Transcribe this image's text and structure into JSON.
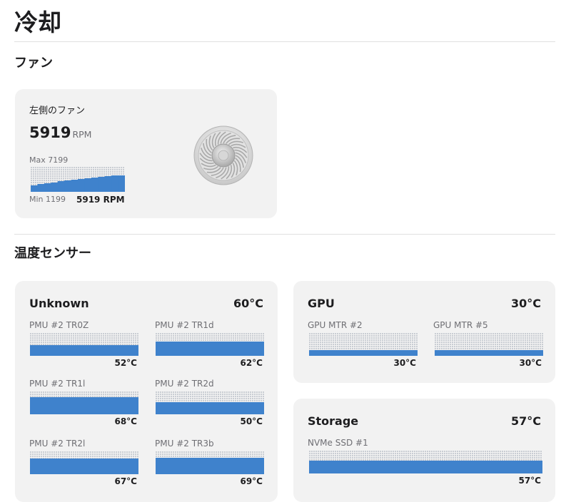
{
  "title": "冷却",
  "fans_section": {
    "title": "ファン",
    "fans": [
      {
        "name": "左側のファン",
        "rpm": "5919",
        "unit": "RPM",
        "max_label": "Max 7199",
        "min_label": "Min 1199",
        "current_label": "5919 RPM",
        "level": 0.65
      }
    ]
  },
  "sensors_section": {
    "title": "温度センサー",
    "groups": [
      {
        "title": "Unknown",
        "temp": "60°C",
        "sensors": [
          {
            "name": "PMU #2 TR0Z",
            "value": "52°C",
            "level": 0.46
          },
          {
            "name": "PMU #2 TR1d",
            "value": "62°C",
            "level": 0.62
          },
          {
            "name": "PMU #2 TR1l",
            "value": "68°C",
            "level": 0.72
          },
          {
            "name": "PMU #2 TR2d",
            "value": "50°C",
            "level": 0.5
          },
          {
            "name": "PMU #2 TR2l",
            "value": "67°C",
            "level": 0.68
          },
          {
            "name": "PMU #2 TR3b",
            "value": "69°C",
            "level": 0.7
          }
        ]
      },
      {
        "title": "GPU",
        "temp": "30°C",
        "sensors": [
          {
            "name": "GPU MTR #2",
            "value": "30°C",
            "level": 0.25
          },
          {
            "name": "GPU MTR #5",
            "value": "30°C",
            "level": 0.25
          }
        ]
      },
      {
        "title": "Storage",
        "temp": "57°C",
        "sensors": [
          {
            "name": "NVMe SSD #1",
            "value": "57°C",
            "level": 0.55
          }
        ]
      }
    ]
  },
  "colors": {
    "bar": "#3f82cc",
    "grid": "#c9cdd3",
    "card": "#f2f2f2"
  },
  "icons": {
    "fan": "fan-icon"
  }
}
